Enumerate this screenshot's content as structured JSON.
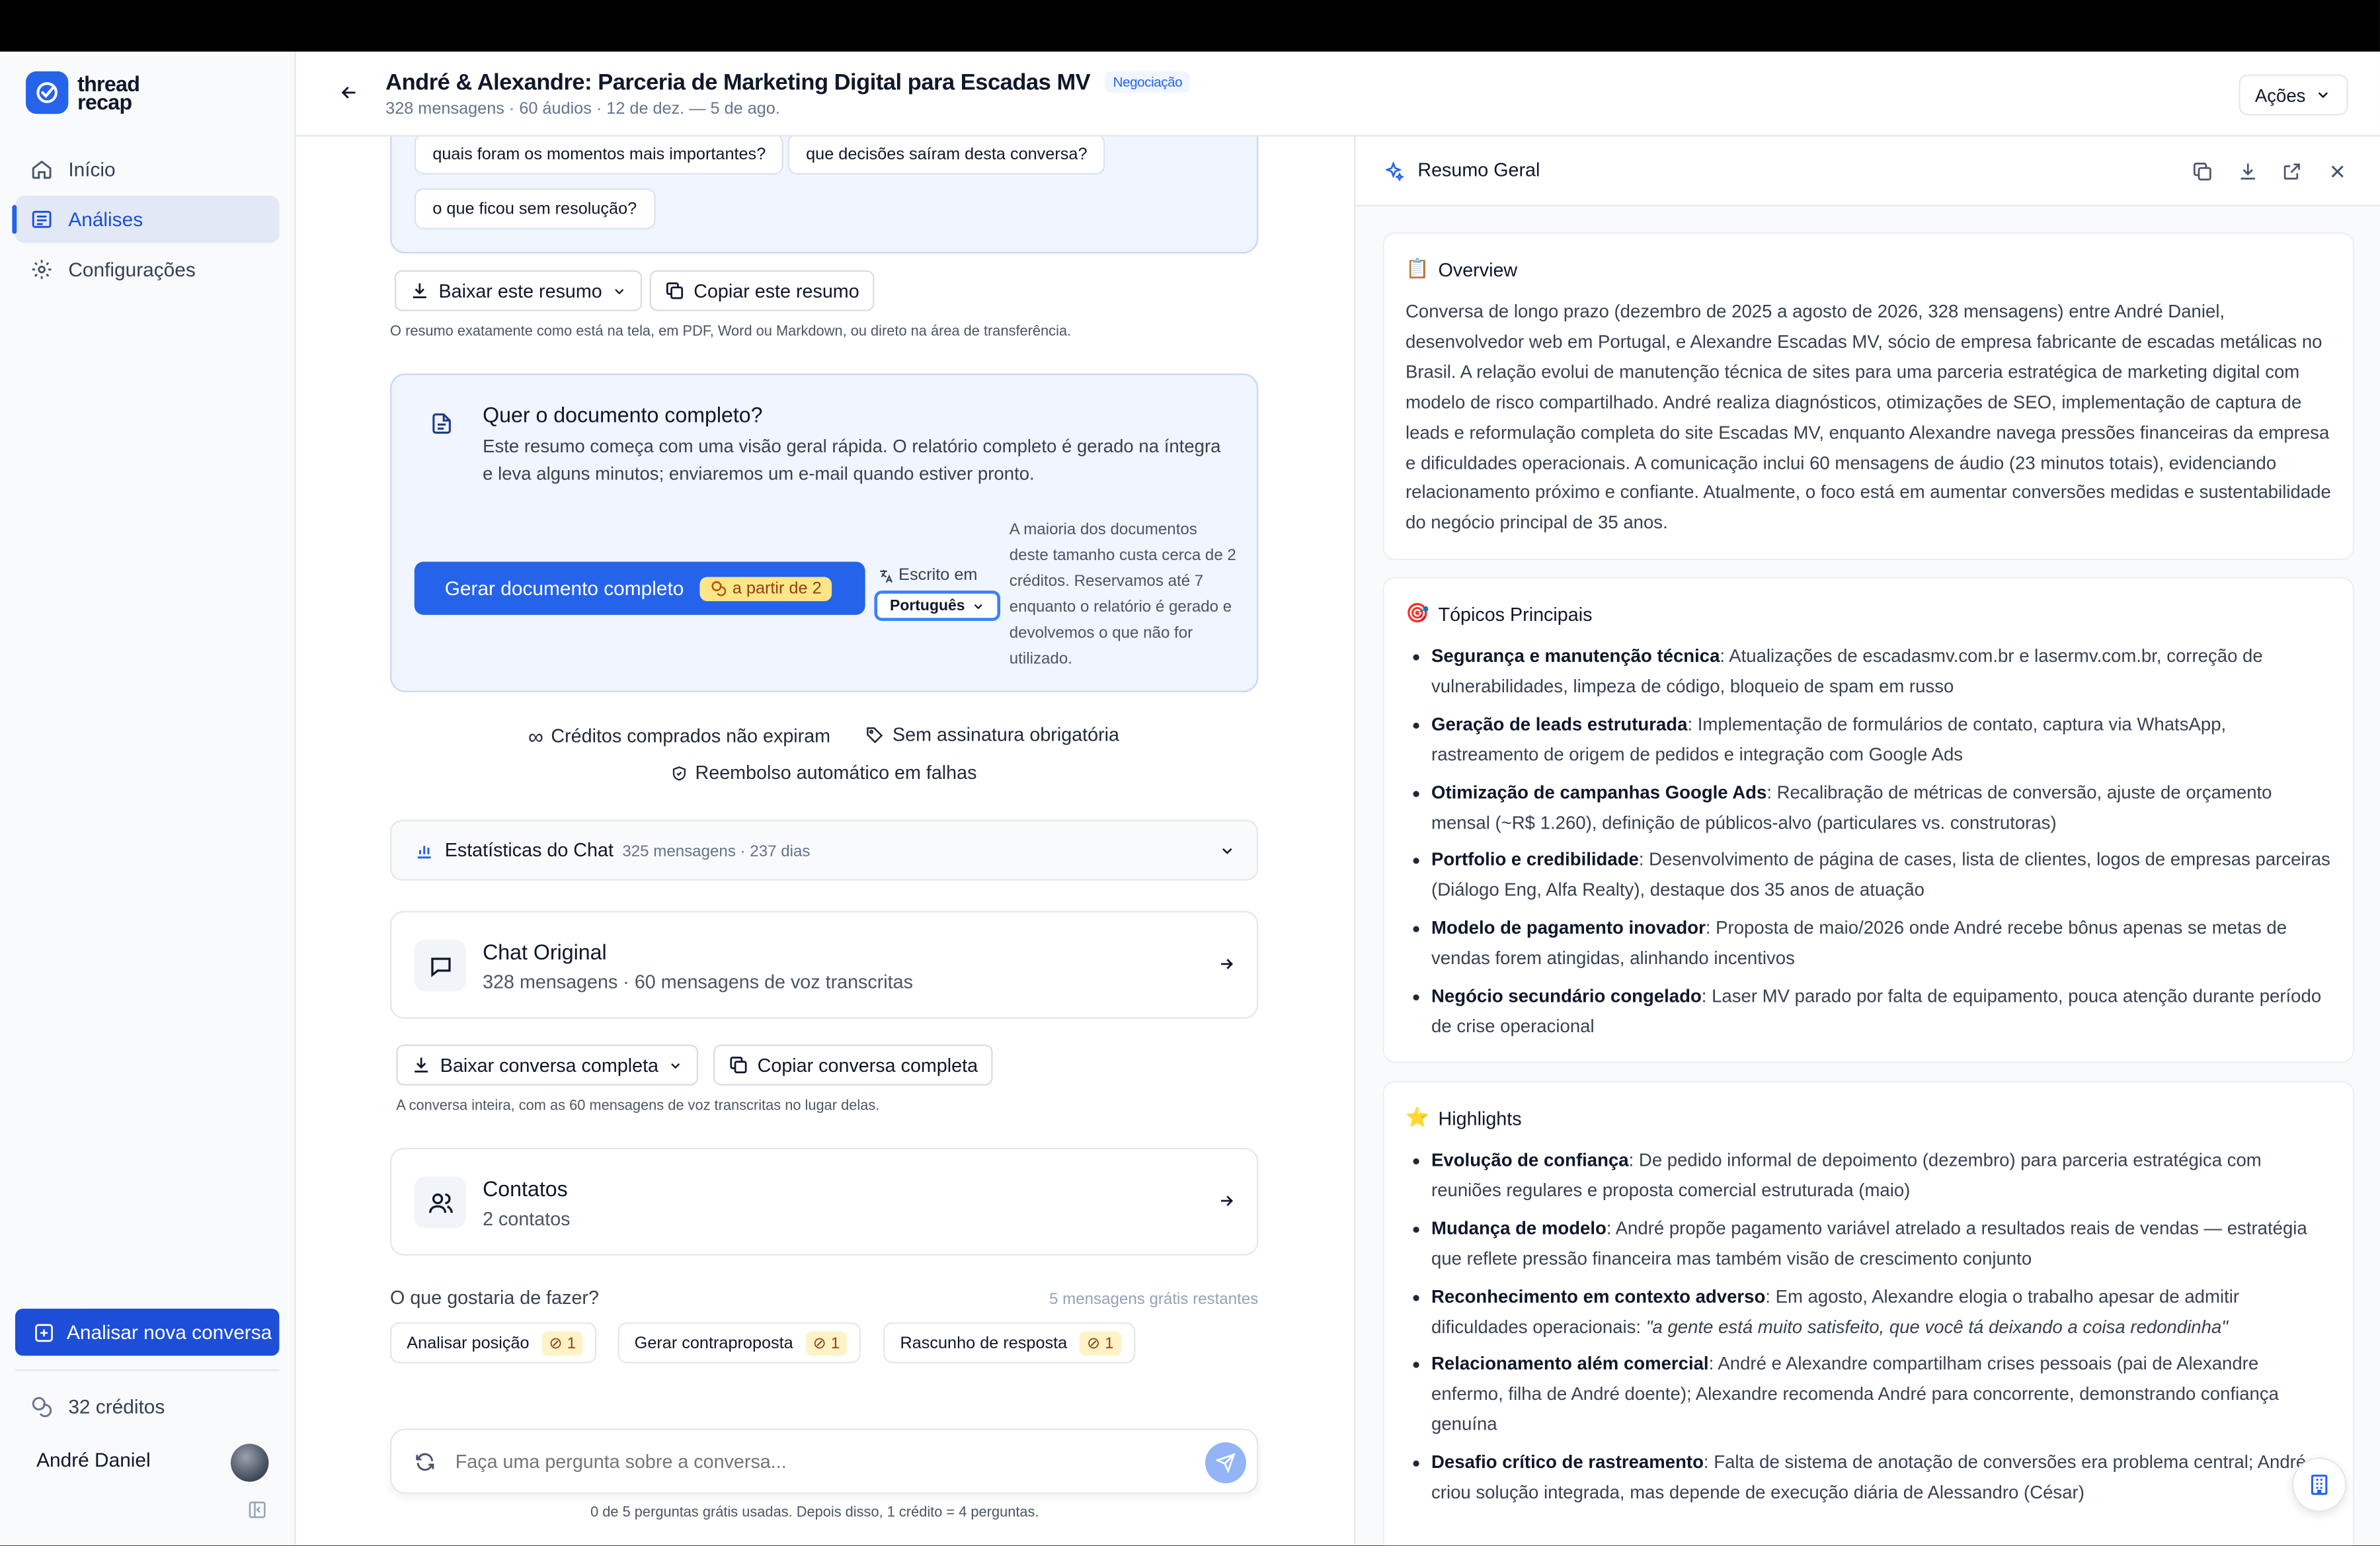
{
  "app": {
    "logo_line1": "thread",
    "logo_line2": "recap"
  },
  "nav": [
    {
      "label": "Início"
    },
    {
      "label": "Análises"
    },
    {
      "label": "Configurações"
    }
  ],
  "sidebar": {
    "new_button": "Analisar nova conversa",
    "credits": "32 créditos",
    "user_name": "André Daniel"
  },
  "header": {
    "title": "André & Alexandre: Parceria de Marketing Digital para Escadas MV",
    "badge": "Negociação",
    "subtitle": "328 mensagens · 60 áudios · 12 de dez. — 5 de ago.",
    "actions": "Ações"
  },
  "suggestions": [
    "quais foram os momentos mais importantes?",
    "que decisões saíram desta conversa?",
    "o que ficou sem resolução?"
  ],
  "summary_tools": {
    "download": "Baixar este resumo",
    "copy": "Copiar este resumo",
    "note": "O resumo exatamente como está na tela, em PDF, Word ou Markdown, ou direto na área de transferência."
  },
  "full_doc": {
    "title": "Quer o documento completo?",
    "desc": "Este resumo começa com uma visão geral rápida. O relatório completo é gerado na íntegra e leva alguns minutos; enviaremos um e-mail quando estiver pronto.",
    "button": "Gerar documento completo",
    "cost": "a partir de 2",
    "lang_label": "Escrito em",
    "lang_value": "Português",
    "side_note": "A maioria dos documentos deste tamanho custa cerca de 2 créditos. Reservamos até 7 enquanto o relatório é gerado e devolvemos o que não for utilizado."
  },
  "perks": [
    "Créditos comprados não expiram",
    "Sem assinatura obrigatória",
    "Reembolso automático em falhas"
  ],
  "stats": {
    "title": "Estatísticas do Chat",
    "meta": "325 mensagens · 237 dias"
  },
  "chat_card": {
    "title": "Chat Original",
    "sub": "328 mensagens · 60 mensagens de voz transcritas"
  },
  "convo_tools": {
    "download": "Baixar conversa completa",
    "copy": "Copiar conversa completa",
    "note": "A conversa inteira, com as 60 mensagens de voz transcritas no lugar delas."
  },
  "contacts_card": {
    "title": "Contatos",
    "sub": "2 contatos"
  },
  "next_actions": {
    "question": "O que gostaria de fazer?",
    "remaining": "5 mensagens grátis restantes",
    "items": [
      {
        "label": "Analisar posição",
        "cost": "1"
      },
      {
        "label": "Gerar contraproposta",
        "cost": "1"
      },
      {
        "label": "Rascunho de resposta",
        "cost": "1"
      }
    ]
  },
  "ask": {
    "placeholder": "Faça uma pergunta sobre a conversa...",
    "note": "0 de 5 perguntas grátis usadas. Depois disso, 1 crédito = 4 perguntas."
  },
  "panel": {
    "title": "Resumo Geral",
    "overview": {
      "icon": "📋",
      "title": "Overview",
      "text": "Conversa de longo prazo (dezembro de 2025 a agosto de 2026, 328 mensagens) entre André Daniel, desenvolvedor web em Portugal, e Alexandre Escadas MV, sócio de empresa fabricante de escadas metálicas no Brasil. A relação evolui de manutenção técnica de sites para uma parceria estratégica de marketing digital com modelo de risco compartilhado. André realiza diagnósticos, otimizações de SEO, implementação de captura de leads e reformulação completa do site Escadas MV, enquanto Alexandre navega pressões financeiras da empresa e dificuldades operacionais. A comunicação inclui 60 mensagens de áudio (23 minutos totais), evidenciando relacionamento próximo e confiante. Atualmente, o foco está em aumentar conversões medidas e sustentabilidade do negócio principal de 35 anos."
    },
    "topics": {
      "icon": "🎯",
      "title": "Tópicos Principais",
      "items": [
        {
          "b": "Segurança e manutenção técnica",
          "t": ": Atualizações de escadasmv.com.br e lasermv.com.br, correção de vulnerabilidades, limpeza de código, bloqueio de spam em russo"
        },
        {
          "b": "Geração de leads estruturada",
          "t": ": Implementação de formulários de contato, captura via WhatsApp, rastreamento de origem de pedidos e integração com Google Ads"
        },
        {
          "b": "Otimização de campanhas Google Ads",
          "t": ": Recalibração de métricas de conversão, ajuste de orçamento mensal (~R$ 1.260), definição de públicos-alvo (particulares vs. construtoras)"
        },
        {
          "b": "Portfolio e credibilidade",
          "t": ": Desenvolvimento de página de cases, lista de clientes, logos de empresas parceiras (Diálogo Eng, Alfa Realty), destaque dos 35 anos de atuação"
        },
        {
          "b": "Modelo de pagamento inovador",
          "t": ": Proposta de maio/2026 onde André recebe bônus apenas se metas de vendas forem atingidas, alinhando incentivos"
        },
        {
          "b": "Negócio secundário congelado",
          "t": ": Laser MV parado por falta de equipamento, pouca atenção durante período de crise operacional"
        }
      ]
    },
    "highlights": {
      "icon": "⭐",
      "title": "Highlights",
      "items": [
        {
          "b": "Evolução de confiança",
          "t": ": De pedido informal de depoimento (dezembro) para parceria estratégica com reuniões regulares e proposta comercial estruturada (maio)",
          "i": ""
        },
        {
          "b": "Mudança de modelo",
          "t": ": André propõe pagamento variável atrelado a resultados reais de vendas — estratégia que reflete pressão financeira mas também visão de crescimento conjunto",
          "i": ""
        },
        {
          "b": "Reconhecimento em contexto adverso",
          "t": ": Em agosto, Alexandre elogia o trabalho apesar de admitir dificuldades operacionais: ",
          "i": "\"a gente está muito satisfeito, que você tá deixando a coisa redondinha\""
        },
        {
          "b": "Relacionamento além comercial",
          "t": ": André e Alexandre compartilham crises pessoais (pai de Alexandre enfermo, filha de André doente); Alexandre recomenda André para concorrente, demonstrando confiança genuína",
          "i": ""
        },
        {
          "b": "Desafio crítico de rastreamento",
          "t": ": Falta de sistema de anotação de conversões era problema central; André criou solução integrada, mas depende de execução diária de Alessandro (César)",
          "i": ""
        }
      ]
    }
  },
  "icons": [
    "home-icon",
    "chart-icon",
    "gear-icon",
    "plus-square-icon",
    "coins-icon",
    "arrow-left-icon",
    "chevron-down-icon",
    "sparkles-icon",
    "copy-icon",
    "download-icon",
    "external-link-icon",
    "close-icon",
    "document-icon",
    "translate-icon",
    "infinity-icon",
    "tag-icon",
    "shield-icon",
    "bar-chart-icon",
    "chat-bubble-icon",
    "users-icon",
    "arrow-right-icon",
    "refresh-icon",
    "send-icon",
    "building-icon"
  ]
}
